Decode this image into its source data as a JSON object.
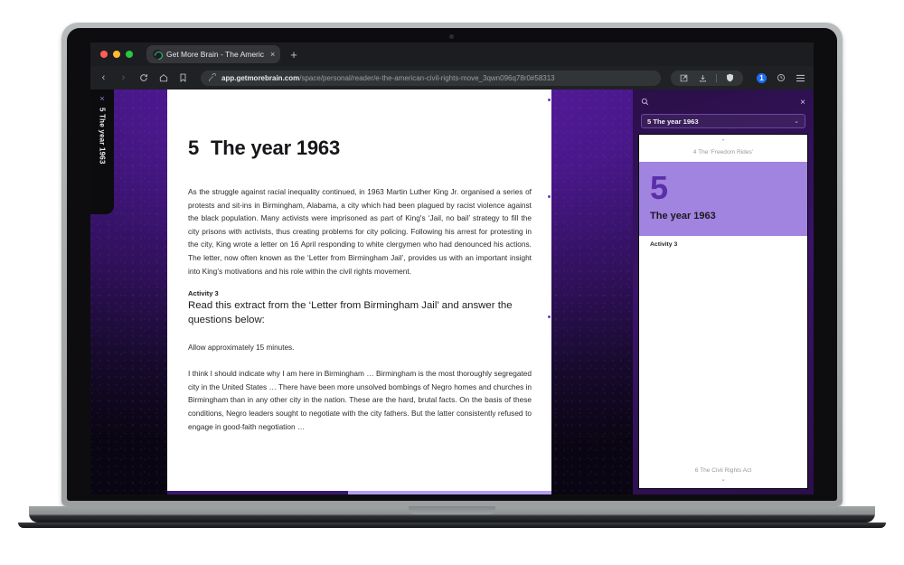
{
  "browser": {
    "traffic_lights": [
      "close",
      "minimize",
      "maximize"
    ],
    "tab": {
      "title": "Get More Brain - The Americ",
      "favicon_name": "getmorebrain-logo",
      "close_label": "×"
    },
    "new_tab_label": "+",
    "nav": {
      "back": "‹",
      "forward": "›",
      "reload": "↻",
      "home": "⌂",
      "bookmark": "☐"
    },
    "url": {
      "domain": "app.getmorebrain.com",
      "path": "/space/personal/reader/e-the-american-civil-rights-move_3qwn096q78r0#58313",
      "lock_icon_name": "site-info-icon"
    },
    "toolbar_right": {
      "share": "share-icon",
      "download": "download-icon",
      "shield": "shield-icon",
      "account_badge": "1",
      "extensions": "extensions-icon",
      "menu": "hamburger-menu-icon"
    }
  },
  "left_tab": {
    "close_label": "×",
    "label": "5 The year 1963"
  },
  "document": {
    "heading_number": "5",
    "heading_title": "The year 1963",
    "paragraph_1": "As the struggle against racial inequality continued, in 1963 Martin Luther King Jr. organised a series of protests and sit-ins in Birmingham, Alabama, a city which had been plagued by racist violence against the black population. Many activists were imprisoned as part of King's ‘Jail, no bail’ strategy to fill the city prisons with activists, thus creating problems for city policing. Following his arrest for protesting in the city, King wrote a letter on 16 April responding to white clergymen who had denounced his actions. The letter, now often known as the ‘Letter from Birmingham Jail’, provides us with an important insight into King’s motivations and his role within the civil rights movement.",
    "activity_label": "Activity 3",
    "activity_text": "Read this extract from the ‘Letter from Birmingham Jail’ and answer the questions below:",
    "time_note": "Allow approximately 15 minutes.",
    "extract": "I think I should indicate why I am here in Birmingham … Birmingham is the most thoroughly segregated city in the United States … There have been more unsolved bombings of Negro homes and churches in Birmingham than in any other city in the nation. These are the hard, brutal facts. On the basis of these conditions, Negro leaders sought to negotiate with the city fathers. But the latter consistently refused to engage in good-faith negotiation …"
  },
  "progress": {
    "percent": 47
  },
  "panel": {
    "search_icon": "search-icon",
    "close_label": "×",
    "selected_chapter": "5 The year 1963",
    "caret_down": "⌄",
    "prev_caret": "⌃",
    "prev_label": "4 The ‘Freedom Rides’",
    "card_number": "5",
    "card_title": "The year 1963",
    "card_color": "#a183e0",
    "items": [
      "Activity 3"
    ],
    "next_label": "6 The Civil Rights Act",
    "next_caret": "⌄"
  }
}
